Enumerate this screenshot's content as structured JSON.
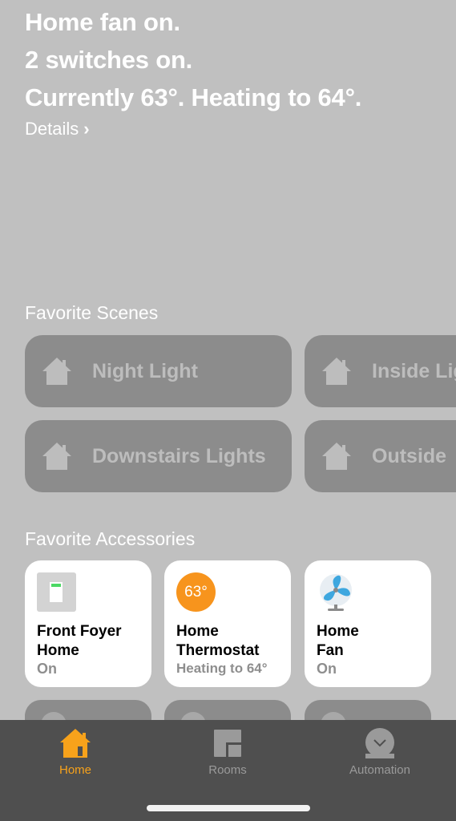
{
  "summary": {
    "lines": [
      "Home fan on.",
      "2 switches on.",
      "Currently 63°. Heating to 64°."
    ],
    "details_label": "Details",
    "details_icon": "chevron-right-icon"
  },
  "favorite_scenes": {
    "title": "Favorite Scenes",
    "items": [
      {
        "label": "Night Light",
        "icon": "house-icon"
      },
      {
        "label": "Inside Lights",
        "icon": "house-icon"
      },
      {
        "label": "Downstairs Lights",
        "icon": "house-icon"
      },
      {
        "label": "Outside",
        "icon": "house-icon"
      }
    ]
  },
  "favorite_accessories": {
    "title": "Favorite Accessories",
    "items": [
      {
        "name_line1": "Front Foyer",
        "name_line2": "Home",
        "status": "On",
        "icon": "light-switch-icon"
      },
      {
        "name_line1": "Home",
        "name_line2": "Thermostat",
        "status": "Heating to 64°",
        "icon": "thermostat-icon",
        "badge": "63°"
      },
      {
        "name_line1": "Home",
        "name_line2": "Fan",
        "status": "On",
        "icon": "fan-icon"
      }
    ]
  },
  "tabbar": {
    "items": [
      {
        "label": "Home",
        "icon": "home-icon",
        "active": true
      },
      {
        "label": "Rooms",
        "icon": "rooms-icon",
        "active": false
      },
      {
        "label": "Automation",
        "icon": "automation-icon",
        "active": false
      }
    ],
    "active_color": "#f59e0b",
    "inactive_color": "#9a9a9a"
  }
}
